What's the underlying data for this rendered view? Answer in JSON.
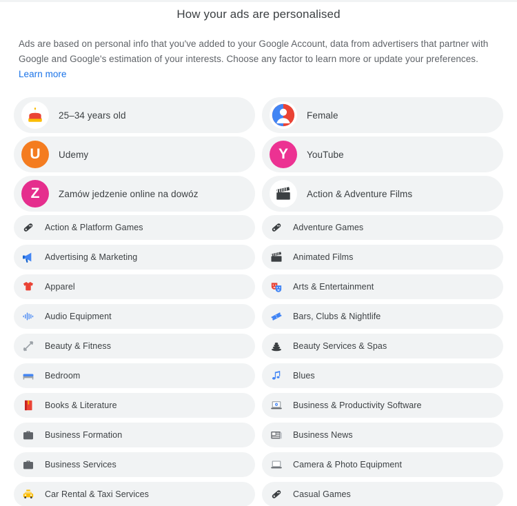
{
  "header": {
    "title": "How your ads are personalised",
    "intro_text": "Ads are based on personal info that you've added to your Google Account, data from advertisers that partner with Google and Google's estimation of your interests. Choose any factor to learn more or update your preferences. ",
    "learn_more_label": "Learn more"
  },
  "colors": {
    "chip_background": "#f1f3f4",
    "link_blue": "#1a73e8",
    "text_primary": "#3c4043",
    "text_secondary": "#5f6368",
    "udemy_orange": "#f47c20",
    "zamow_pink": "#e52e8d",
    "youtube_pink": "#ec3292",
    "apparel_red": "#e8453c",
    "accent_blue": "#4285f4",
    "page_background": "#ffffff"
  },
  "columns": {
    "left": [
      {
        "label": "25–34 years old",
        "icon": "birthday-cake-icon",
        "size": "large"
      },
      {
        "label": "Udemy",
        "icon": "udemy-letter-icon",
        "size": "large",
        "letter": "U",
        "bg": "#f47c20"
      },
      {
        "label": "Zamów jedzenie online na dowóz",
        "icon": "zamow-letter-icon",
        "size": "large",
        "letter": "Z",
        "bg": "#e52e8d"
      },
      {
        "label": "Action & Platform Games",
        "icon": "gamepad-icon",
        "size": "small"
      },
      {
        "label": "Advertising & Marketing",
        "icon": "megaphone-icon",
        "size": "small"
      },
      {
        "label": "Apparel",
        "icon": "tshirt-icon",
        "size": "small"
      },
      {
        "label": "Audio Equipment",
        "icon": "audio-waveform-icon",
        "size": "small"
      },
      {
        "label": "Beauty & Fitness",
        "icon": "dumbbell-icon",
        "size": "small"
      },
      {
        "label": "Bedroom",
        "icon": "bed-icon",
        "size": "small"
      },
      {
        "label": "Books & Literature",
        "icon": "book-icon",
        "size": "small"
      },
      {
        "label": "Business Formation",
        "icon": "briefcase-icon",
        "size": "small"
      },
      {
        "label": "Business Services",
        "icon": "briefcase-icon",
        "size": "small"
      },
      {
        "label": "Car Rental & Taxi Services",
        "icon": "taxi-icon",
        "size": "small"
      }
    ],
    "right": [
      {
        "label": "Female",
        "icon": "person-avatar-icon",
        "size": "large"
      },
      {
        "label": "YouTube",
        "icon": "youtube-letter-icon",
        "size": "large",
        "letter": "Y",
        "bg": "#ec3292"
      },
      {
        "label": "Action & Adventure Films",
        "icon": "clapperboard-icon",
        "size": "large"
      },
      {
        "label": "Adventure Games",
        "icon": "gamepad-icon",
        "size": "small"
      },
      {
        "label": "Animated Films",
        "icon": "clapperboard-icon",
        "size": "small"
      },
      {
        "label": "Arts & Entertainment",
        "icon": "theatre-masks-icon",
        "size": "small"
      },
      {
        "label": "Bars, Clubs & Nightlife",
        "icon": "ticket-icon",
        "size": "small"
      },
      {
        "label": "Beauty Services & Spas",
        "icon": "spa-stones-icon",
        "size": "small"
      },
      {
        "label": "Blues",
        "icon": "music-note-icon",
        "size": "small"
      },
      {
        "label": "Business & Productivity Software",
        "icon": "laptop-gear-icon",
        "size": "small"
      },
      {
        "label": "Business News",
        "icon": "newspaper-icon",
        "size": "small"
      },
      {
        "label": "Camera & Photo Equipment",
        "icon": "laptop-icon",
        "size": "small"
      },
      {
        "label": "Casual Games",
        "icon": "gamepad-icon",
        "size": "small"
      }
    ]
  }
}
